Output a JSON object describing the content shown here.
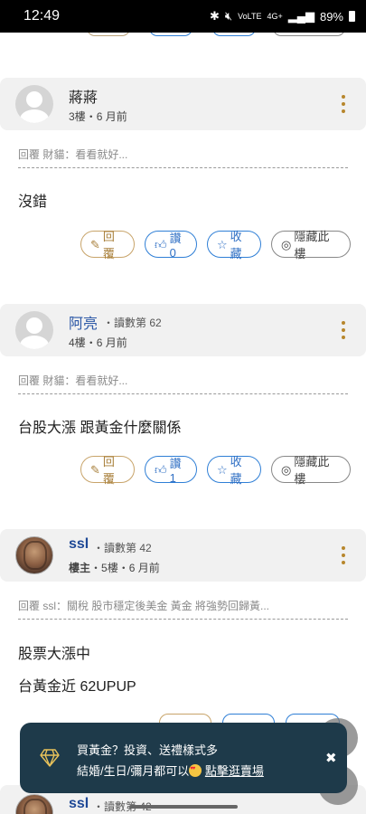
{
  "status_bar": {
    "time": "12:49",
    "network": "4G+",
    "volte": "VoLTE",
    "battery": "89%"
  },
  "posts": [
    {
      "author": "蔣蔣",
      "badge": "",
      "floor": "3樓",
      "time": "6 月前",
      "reply_quote": "回覆 財貓：看看就好...",
      "content": [
        "沒錯"
      ],
      "actions": {
        "reply": "回覆",
        "like": "讚 0",
        "fav": "收藏",
        "hide": "隱藏此樓"
      }
    },
    {
      "author": "阿亮",
      "badge": "・讀數第 62",
      "floor": "4樓",
      "time": "6 月前",
      "reply_quote": "回覆 財貓：看看就好...",
      "content": [
        "台股大漲 跟黃金什麼關係"
      ],
      "actions": {
        "reply": "回覆",
        "like": "讚 1",
        "fav": "收藏",
        "hide": "隱藏此樓"
      }
    },
    {
      "author": "ssl",
      "badge": "・讀數第 42",
      "op_label": "樓主",
      "floor": "5樓",
      "time": "6 月前",
      "reply_quote": "回覆 ssl：關稅 股市穩定後美金 黃金 將強勢回歸黃...",
      "content": [
        "股票大漲中",
        "台黃金近 62UPUP"
      ]
    },
    {
      "author": "ssl",
      "badge": "・讀數第 42"
    }
  ],
  "separator": "・",
  "toast": {
    "line1": "買黃金？投資、送禮樣式多",
    "line2_prefix": "結婚/生日/彌月都可以",
    "line2_link": "點擊逛賣場",
    "close": "✖"
  }
}
